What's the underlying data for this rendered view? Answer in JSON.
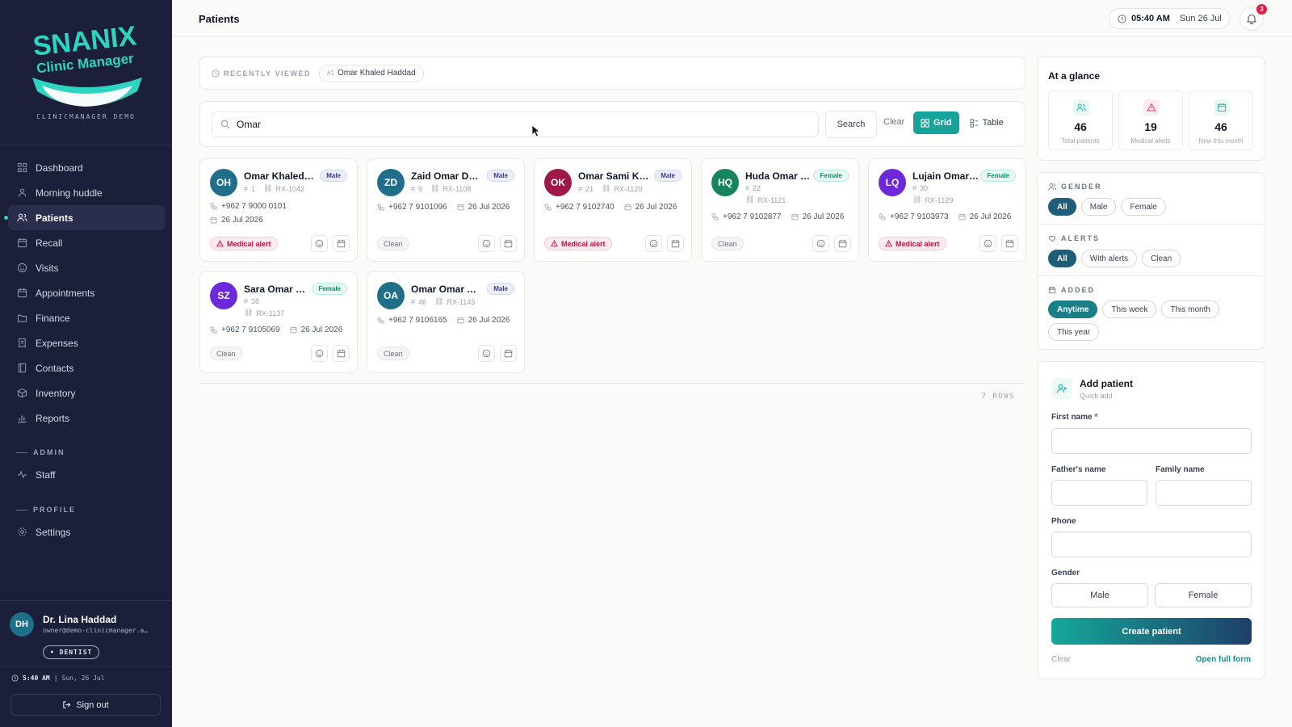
{
  "brand": {
    "name": "SNANIX",
    "subtitle": "Clinic Manager",
    "caption": "CLINICMANAGER DEMO",
    "color_primary": "#15a89a",
    "color_sidebar": "#1c1f3a"
  },
  "nav": {
    "items": [
      {
        "label": "Dashboard",
        "icon": "grid-icon"
      },
      {
        "label": "Morning huddle",
        "icon": "people-icon"
      },
      {
        "label": "Patients",
        "icon": "users-icon",
        "active": true
      },
      {
        "label": "Recall",
        "icon": "calendar-icon"
      },
      {
        "label": "Visits",
        "icon": "smile-icon"
      },
      {
        "label": "Appointments",
        "icon": "calendar-icon"
      },
      {
        "label": "Finance",
        "icon": "folder-icon"
      },
      {
        "label": "Expenses",
        "icon": "receipt-icon"
      },
      {
        "label": "Contacts",
        "icon": "book-icon"
      },
      {
        "label": "Inventory",
        "icon": "box-icon"
      },
      {
        "label": "Reports",
        "icon": "chart-icon"
      }
    ],
    "admin_section": "ADMIN",
    "admin_items": [
      {
        "label": "Staff",
        "icon": "activity-icon"
      }
    ],
    "profile_section": "PROFILE",
    "profile_items": [
      {
        "label": "Settings",
        "icon": "gear-icon"
      }
    ]
  },
  "user": {
    "initials": "DH",
    "name": "Dr. Lina Haddad",
    "email": "owner@demo-clinicmanager.a…",
    "role": "• DENTIST",
    "time": "5:40 AM",
    "date": "Sun, 26 Jul",
    "signout_label": "Sign out"
  },
  "header": {
    "title": "Patients",
    "time": "05:40 AM",
    "date": "Sun 26 Jul",
    "notifications": "3"
  },
  "recent": {
    "label": "RECENTLY VIEWED",
    "chip_num": "#1",
    "chip_name": "Omar Khaled Haddad"
  },
  "search": {
    "value": "Omar",
    "button": "Search",
    "clear": "Clear",
    "view_grid": "Grid",
    "view_table": "Table",
    "active_view": "Grid"
  },
  "patients": [
    {
      "initials": "OH",
      "avatar_color": "#1f6f8b",
      "name": "Omar Khaled …",
      "gender": "Male",
      "id": "1",
      "rx": "RX-1042",
      "phone": "+962 7 9000 0101",
      "date": "26 Jul 2026",
      "status": "Medical alert"
    },
    {
      "initials": "ZD",
      "avatar_color": "#1f6f8b",
      "name": "Zaid Omar Da…",
      "gender": "Male",
      "id": "9",
      "rx": "RX-1108",
      "phone": "+962 7 9101096",
      "date": "26 Jul 2026",
      "status": "Clean"
    },
    {
      "initials": "OK",
      "avatar_color": "#a01848",
      "name": "Omar Sami K…",
      "gender": "Male",
      "id": "21",
      "rx": "RX-1120",
      "phone": "+962 7 9102740",
      "date": "26 Jul 2026",
      "status": "Medical alert"
    },
    {
      "initials": "HQ",
      "avatar_color": "#15845f",
      "name": "Huda Omar …",
      "gender": "Female",
      "id": "22",
      "rx": "RX-1121",
      "phone": "+962 7 9102877",
      "date": "26 Jul 2026",
      "status": "Clean"
    },
    {
      "initials": "LQ",
      "avatar_color": "#6d28d9",
      "name": "Lujain Omar…",
      "gender": "Female",
      "id": "30",
      "rx": "RX-1129",
      "phone": "+962 7 9103973",
      "date": "26 Jul 2026",
      "status": "Medical alert"
    },
    {
      "initials": "SZ",
      "avatar_color": "#6d28d9",
      "name": "Sara Omar …",
      "gender": "Female",
      "id": "38",
      "rx": "RX-1137",
      "phone": "+962 7 9105069",
      "date": "26 Jul 2026",
      "status": "Clean"
    },
    {
      "initials": "OA",
      "avatar_color": "#1f6f8b",
      "name": "Omar Omar Al…",
      "gender": "Male",
      "id": "46",
      "rx": "RX-1145",
      "phone": "+962 7 9106165",
      "date": "26 Jul 2026",
      "status": "Clean"
    }
  ],
  "rows_label": "7 ROWS",
  "glance": {
    "title": "At a glance",
    "stats": [
      {
        "value": "46",
        "label": "Total patients",
        "icon": "users-icon",
        "color": "#15a89a"
      },
      {
        "value": "19",
        "label": "Medical alerts",
        "icon": "warning-icon",
        "color": "#e11d48"
      },
      {
        "value": "46",
        "label": "New this month",
        "icon": "calendar-icon",
        "color": "#15a89a"
      }
    ]
  },
  "filters": {
    "gender_title": "GENDER",
    "gender_options": [
      "All",
      "Male",
      "Female"
    ],
    "alerts_title": "ALERTS",
    "alerts_options": [
      "All",
      "With alerts",
      "Clean"
    ],
    "added_title": "ADDED",
    "added_options": [
      "Anytime",
      "This week",
      "This month",
      "This year"
    ]
  },
  "add_patient": {
    "title": "Add patient",
    "subtitle": "Quick add",
    "first_name": "First name",
    "required_mark": "*",
    "father_name": "Father's name",
    "family_name": "Family name",
    "phone": "Phone",
    "gender": "Gender",
    "male": "Male",
    "female": "Female",
    "create": "Create patient",
    "clear": "Clear",
    "open_full": "Open full form"
  }
}
